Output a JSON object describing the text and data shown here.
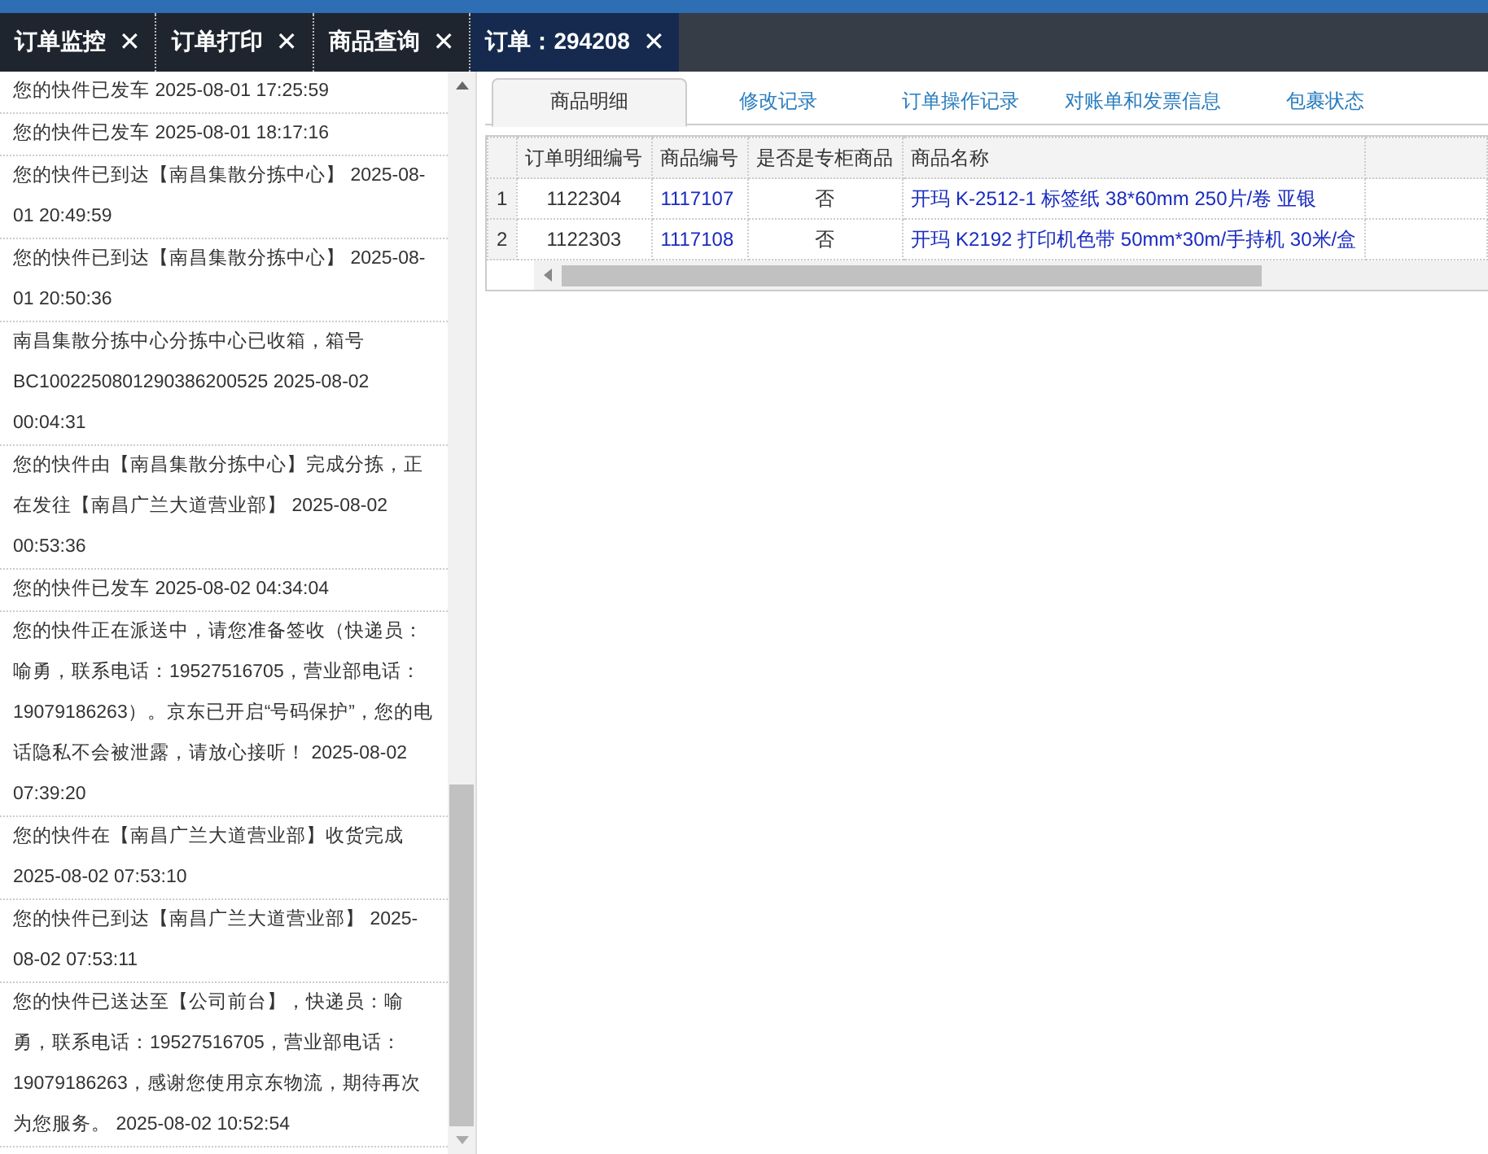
{
  "tabs": [
    {
      "label": "订单监控",
      "close": "✕",
      "selected": false
    },
    {
      "label": "订单打印",
      "close": "✕",
      "selected": false
    },
    {
      "label": "商品查询",
      "close": "✕",
      "selected": false
    },
    {
      "label": "订单：294208",
      "close": "✕",
      "selected": true
    }
  ],
  "tracking_log": [
    "您的快件已发车 2025-08-01 17:25:59",
    "您的快件已发车 2025-08-01 18:17:16",
    "您的快件已到达【南昌集散分拣中心】 2025-08-01 20:49:59",
    "您的快件已到达【南昌集散分拣中心】 2025-08-01 20:50:36",
    "南昌集散分拣中心分拣中心已收箱，箱号BC1002250801290386200525 2025-08-02 00:04:31",
    "您的快件由【南昌集散分拣中心】完成分拣，正在发往【南昌广兰大道营业部】 2025-08-02 00:53:36",
    "您的快件已发车 2025-08-02 04:34:04",
    "您的快件正在派送中，请您准备签收（快递员：喻勇，联系电话：19527516705，营业部电话：19079186263）。京东已开启“号码保护”，您的电话隐私不会被泄露，请放心接听！ 2025-08-02 07:39:20",
    "您的快件在【南昌广兰大道营业部】收货完成 2025-08-02 07:53:10",
    "您的快件已到达【南昌广兰大道营业部】 2025-08-02 07:53:11",
    "您的快件已送达至【公司前台】，快递员：喻勇，联系电话：19527516705，营业部电话：19079186263，感谢您使用京东物流，期待再次为您服务。 2025-08-02 10:52:54"
  ],
  "detail_tabs": [
    {
      "label": "商品明细",
      "selected": true
    },
    {
      "label": "修改记录",
      "selected": false
    },
    {
      "label": "订单操作记录",
      "selected": false
    },
    {
      "label": "对账单和发票信息",
      "selected": false
    },
    {
      "label": "包裹状态",
      "selected": false
    }
  ],
  "table": {
    "columns": [
      "订单明细编号",
      "商品编号",
      "是否是专柜商品",
      "商品名称"
    ],
    "rows": [
      {
        "index": "1",
        "cells": [
          "1122304",
          "1117107",
          "否",
          "开玛 K-2512-1 标签纸 38*60mm 250片/卷 亚银"
        ]
      },
      {
        "index": "2",
        "cells": [
          "1122303",
          "1117108",
          "否",
          "开玛 K2192 打印机色带 50mm*30m/手持机 30米/盒"
        ]
      }
    ]
  }
}
